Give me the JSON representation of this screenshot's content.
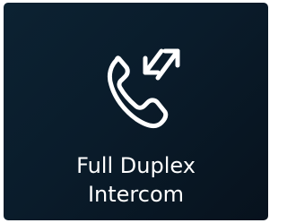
{
  "tile": {
    "icon": "phone-duplex-arrows-icon",
    "label_line1": "Full Duplex",
    "label_line2": "Intercom",
    "background_color": "#0a1c2b",
    "text_color": "#ffffff"
  }
}
